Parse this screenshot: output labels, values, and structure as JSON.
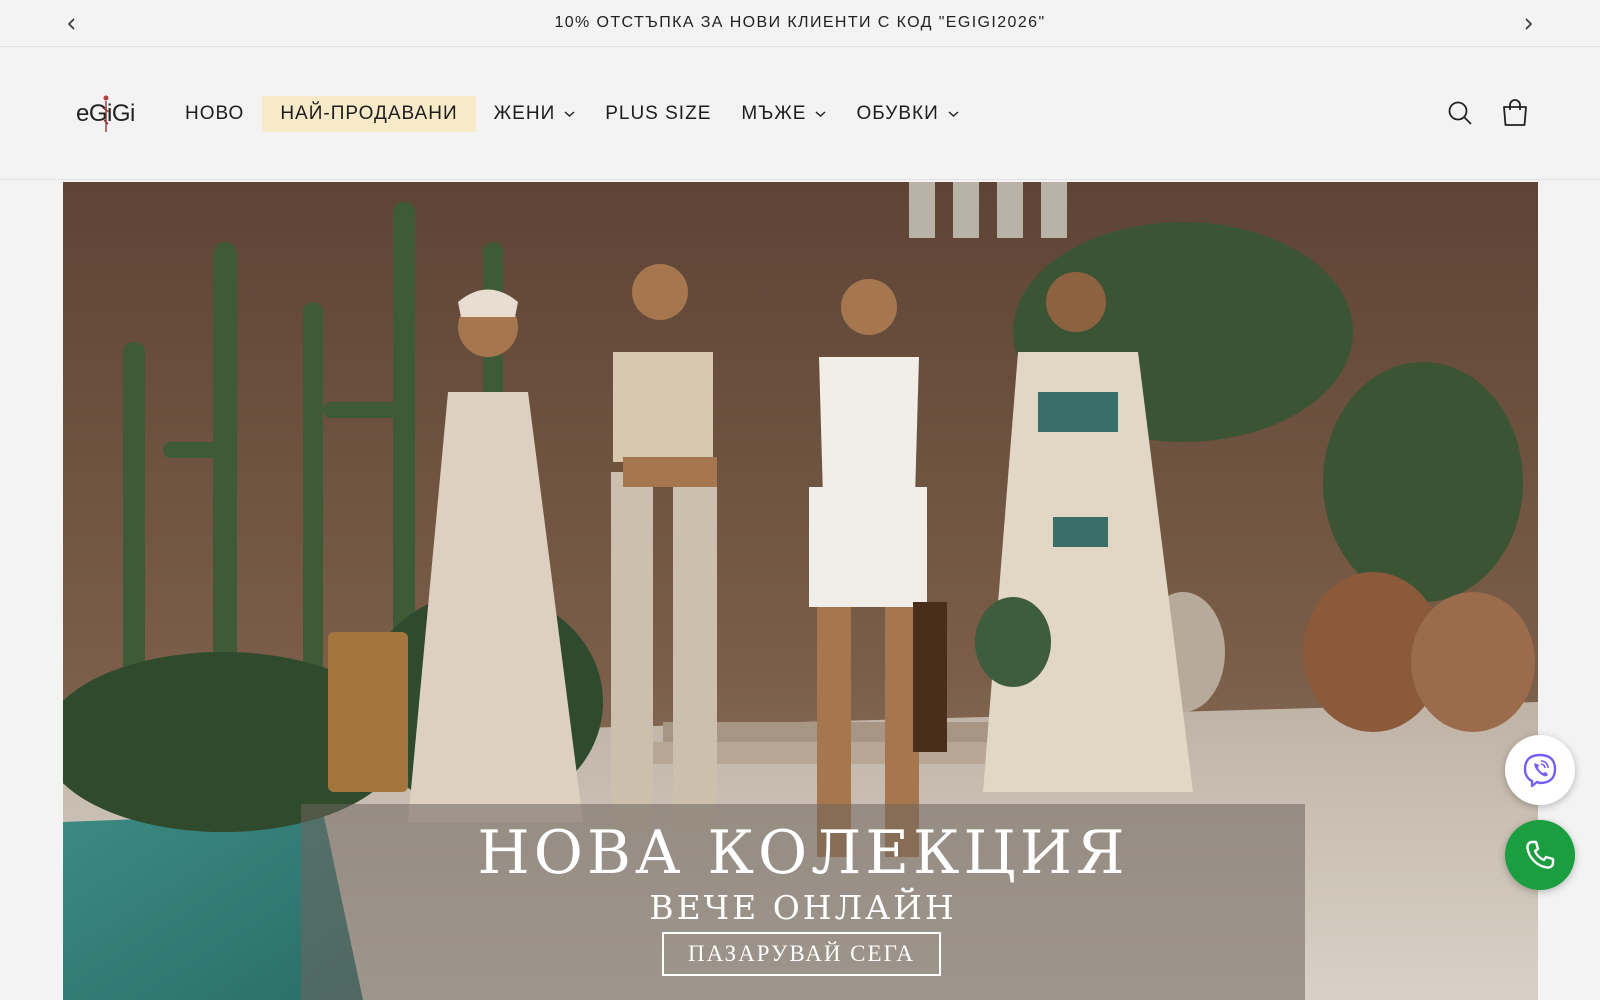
{
  "announcement": {
    "text": "10% ОТСТЪПКА ЗА НОВИ КЛИЕНТИ С КОД \"EGIGI2026\"",
    "prev_icon": "chevron-left-icon",
    "next_icon": "chevron-right-icon"
  },
  "header": {
    "logo_text": "eGiGi",
    "nav": [
      {
        "label": "НОВО",
        "dropdown": false
      },
      {
        "label": "НАЙ-ПРОДАВАНИ",
        "dropdown": false,
        "highlight": true
      },
      {
        "label": "ЖЕНИ",
        "dropdown": true
      },
      {
        "label": "PLUS SIZE",
        "dropdown": false
      },
      {
        "label": "МЪЖЕ",
        "dropdown": true
      },
      {
        "label": "ОБУВКИ",
        "dropdown": true
      }
    ],
    "icons": [
      "search-icon",
      "cart-icon"
    ]
  },
  "hero": {
    "title": "НОВА КОЛЕКЦИЯ",
    "subtitle": "ВЕЧЕ ОНЛАЙН",
    "cta": "ПАЗАРУВАЙ СЕГА"
  },
  "floating": {
    "viber_icon": "viber-icon",
    "phone_icon": "phone-icon"
  },
  "colors": {
    "page_bg": "#f3f3f3",
    "highlight_bg": "#f6eac8",
    "phone_green": "#1a9e3f",
    "viber_purple": "#7360f2"
  }
}
